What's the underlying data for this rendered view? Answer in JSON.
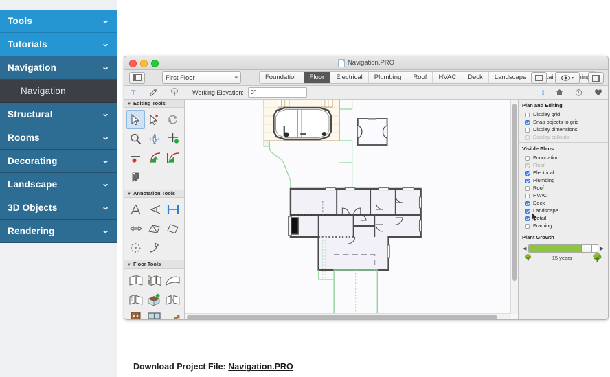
{
  "sidebar": {
    "items": [
      {
        "label": "Tools",
        "level": 0,
        "icon": "chevron-down-icon",
        "expanded": false
      },
      {
        "label": "Tutorials",
        "level": 0,
        "icon": "chevron-down-icon",
        "expanded": true
      },
      {
        "label": "Navigation",
        "level": 1,
        "icon": "chevron-down-icon",
        "expanded": true
      },
      {
        "label": "Navigation",
        "level": 2,
        "icon": "",
        "expanded": false
      },
      {
        "label": "Structural",
        "level": 1,
        "icon": "chevron-down-icon",
        "expanded": false
      },
      {
        "label": "Rooms",
        "level": 1,
        "icon": "chevron-down-icon",
        "expanded": false
      },
      {
        "label": "Decorating",
        "level": 1,
        "icon": "chevron-down-icon",
        "expanded": false
      },
      {
        "label": "Landscape",
        "level": 1,
        "icon": "chevron-down-icon",
        "expanded": false
      },
      {
        "label": "3D Objects",
        "level": 1,
        "icon": "chevron-down-icon",
        "expanded": false
      },
      {
        "label": "Rendering",
        "level": 1,
        "icon": "chevron-down-icon",
        "expanded": false
      }
    ],
    "chevron_glyph": "⌄",
    "colors": {
      "level0": "#2596d2",
      "level1": "#2d6d93",
      "level2": "#3a4046"
    }
  },
  "window": {
    "title": "Navigation.PRO",
    "doc_icon": "document-icon",
    "traffic_lights": [
      "close",
      "minimize",
      "zoom"
    ]
  },
  "toolbar": {
    "left_panel_toggle_icon": "show-left-sidebar-icon",
    "right_panel_toggle_icon": "show-right-sidebar-icon",
    "floor_selector": {
      "value": "First Floor",
      "caret": "▾"
    },
    "plan_tabs": [
      {
        "label": "Foundation",
        "active": false
      },
      {
        "label": "Floor",
        "active": true
      },
      {
        "label": "Electrical",
        "active": false
      },
      {
        "label": "Plumbing",
        "active": false
      },
      {
        "label": "Roof",
        "active": false
      },
      {
        "label": "HVAC",
        "active": false
      },
      {
        "label": "Deck",
        "active": false
      },
      {
        "label": "Landscape",
        "active": false
      },
      {
        "label": "Detail",
        "active": false
      },
      {
        "label": "Framing",
        "active": false
      }
    ],
    "layout_button_icon": "split-view-icon",
    "eye_button_icon": "eye-icon",
    "eye_caret": "▾"
  },
  "elevation_bar": {
    "quick_tools": [
      "text-tool-icon",
      "eyedropper-tool-icon",
      "plant-tool-icon"
    ],
    "label": "Working Elevation:",
    "value": "0\"",
    "right_icons": [
      "info-icon",
      "house-icon",
      "clock-icon",
      "heart-icon"
    ]
  },
  "palette": {
    "sections": [
      {
        "title": "Editing Tools",
        "triangle": "▼",
        "tools": [
          {
            "name": "select-arrow-tool",
            "selected": true
          },
          {
            "name": "select-point-tool",
            "selected": false
          },
          {
            "name": "refresh-rotate-tool",
            "selected": false
          },
          {
            "name": "zoom-magnifier-tool",
            "selected": false
          },
          {
            "name": "pan-move-tool",
            "selected": false
          },
          {
            "name": "add-point-tool",
            "selected": false
          },
          {
            "name": "delete-point-tool",
            "selected": false
          },
          {
            "name": "fillet-corner-tool",
            "selected": false
          },
          {
            "name": "chamfer-corner-tool",
            "selected": false
          },
          {
            "name": "camera-view-tool",
            "selected": false
          }
        ]
      },
      {
        "title": "Annotation Tools",
        "triangle": "▼",
        "tools": [
          {
            "name": "text-annotation-tool",
            "selected": false
          },
          {
            "name": "callout-tool",
            "selected": false
          },
          {
            "name": "dimension-tool",
            "selected": true
          },
          {
            "name": "arrow-tool",
            "selected": false
          },
          {
            "name": "polyline-tool",
            "selected": false
          },
          {
            "name": "rectangle-tool",
            "selected": false
          },
          {
            "name": "spray-pattern-tool",
            "selected": false
          },
          {
            "name": "pointer-marker-tool",
            "selected": false
          }
        ]
      },
      {
        "title": "Floor Tools",
        "triangle": "▼",
        "tools": [
          {
            "name": "straight-wall-tool",
            "selected": false
          },
          {
            "name": "paint-wall-tool",
            "selected": false
          },
          {
            "name": "curved-wall-tool",
            "selected": false
          },
          {
            "name": "room-divider-tool",
            "selected": false
          },
          {
            "name": "build-house-tool",
            "selected": false
          },
          {
            "name": "break-wall-tool",
            "selected": false
          },
          {
            "name": "door-tool",
            "selected": false
          },
          {
            "name": "window-tool",
            "selected": false
          },
          {
            "name": "stairs-tool",
            "selected": false
          }
        ]
      }
    ]
  },
  "inspector": {
    "plan_editing": {
      "title": "Plan and Editing",
      "options": [
        {
          "label": "Display grid",
          "checked": false,
          "disabled": false
        },
        {
          "label": "Snap objects to grid",
          "checked": true,
          "disabled": false
        },
        {
          "label": "Display dimensions",
          "checked": false,
          "disabled": false
        },
        {
          "label": "Display callouts",
          "checked": false,
          "disabled": true
        }
      ]
    },
    "visible_plans": {
      "title": "Visible Plans",
      "options": [
        {
          "label": "Foundation",
          "checked": false,
          "disabled": false
        },
        {
          "label": "Floor",
          "checked": true,
          "disabled": true
        },
        {
          "label": "Electrical",
          "checked": true,
          "disabled": false
        },
        {
          "label": "Plumbing",
          "checked": true,
          "disabled": false
        },
        {
          "label": "Roof",
          "checked": false,
          "disabled": false
        },
        {
          "label": "HVAC",
          "checked": false,
          "disabled": false
        },
        {
          "label": "Deck",
          "checked": true,
          "disabled": false
        },
        {
          "label": "Landscape",
          "checked": true,
          "disabled": false
        },
        {
          "label": "Detail",
          "checked": true,
          "disabled": false
        },
        {
          "label": "Framing",
          "checked": false,
          "disabled": false
        }
      ]
    },
    "plant_growth": {
      "title": "Plant Growth",
      "value": "15 years",
      "fill_percent": 78,
      "left_arrow": "◀",
      "right_arrow": "▶",
      "small_tree_icon": "small-tree-icon",
      "large_tree_icon": "large-tree-icon",
      "fill_color": "#8cc63f"
    }
  },
  "footer": {
    "prefix": "Download Project File: ",
    "link_text": "Navigation.PRO"
  }
}
